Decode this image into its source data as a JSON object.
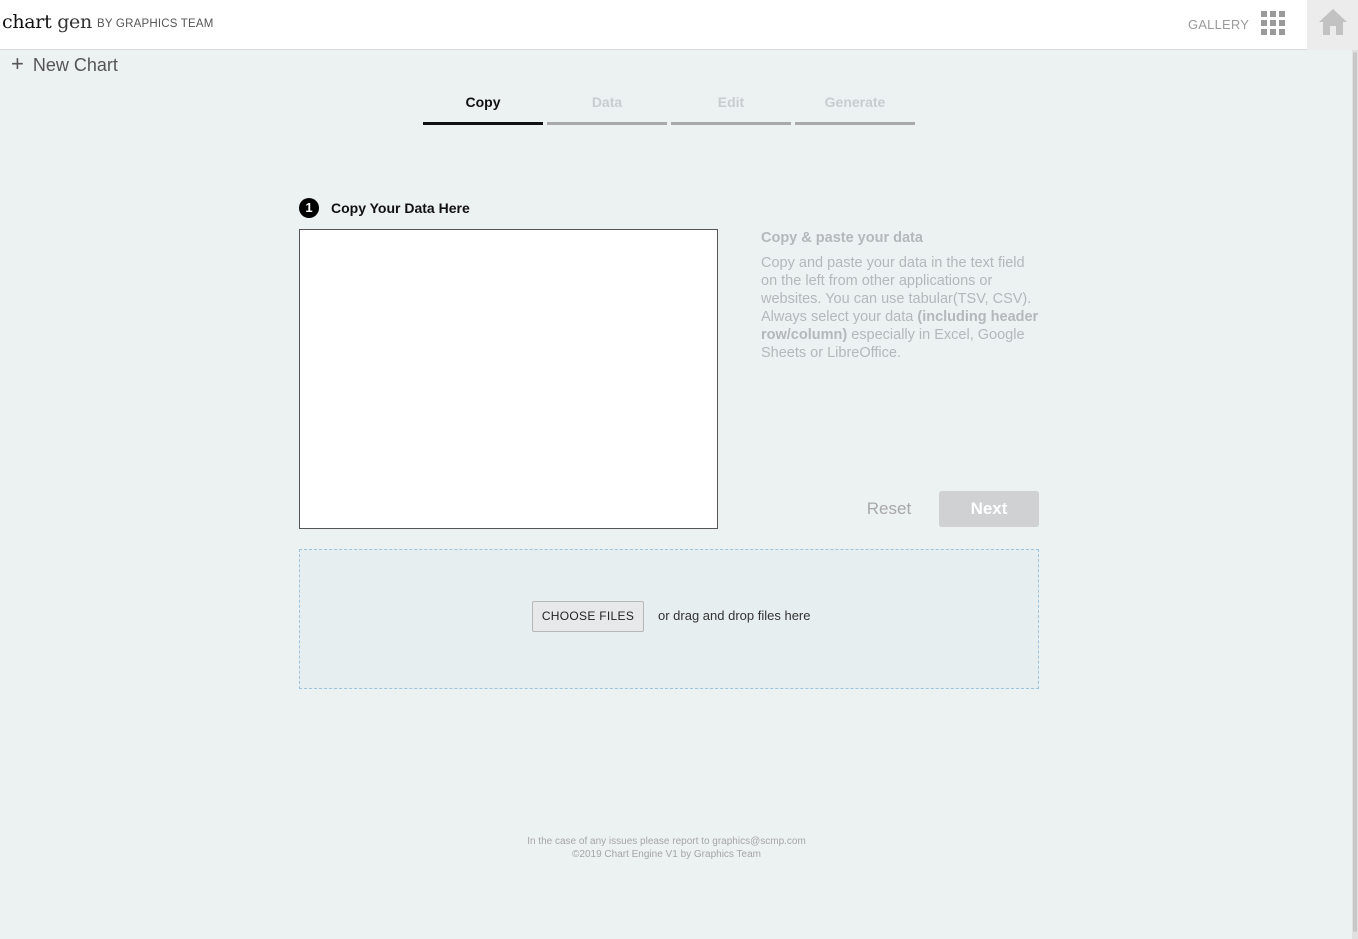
{
  "header": {
    "brand_bold": "chart",
    "brand_light": "gen",
    "byline": "BY GRAPHICS TEAM",
    "gallery_label": "GALLERY",
    "apps_icon": "grid-icon",
    "home_icon": "home-icon"
  },
  "sidebar": {
    "new_chart_label": "New Chart",
    "new_chart_icon": "+"
  },
  "steps": [
    {
      "label": "Copy",
      "active": true
    },
    {
      "label": "Data",
      "active": false
    },
    {
      "label": "Edit",
      "active": false
    },
    {
      "label": "Generate",
      "active": false
    }
  ],
  "copy_section": {
    "step_number": "1",
    "title": "Copy Your Data Here",
    "textarea_value": "",
    "help_title": "Copy & paste your data",
    "help_text_1": "Copy and paste your data in the text field on the left from other applications or websites. You can use tabular(TSV, CSV). Always select your data ",
    "help_text_bold": "(including header row/column)",
    "help_text_2": " especially in Excel, Google Sheets or LibreOffice.",
    "reset_label": "Reset",
    "next_label": "Next"
  },
  "upload": {
    "choose_label": "CHOOSE FILES",
    "drop_text": "or drag and drop files here"
  },
  "footer": {
    "line1": "In the case of any issues please report to graphics@scmp.com",
    "line2": "©2019 Chart Engine V1 by Graphics Team"
  },
  "colors": {
    "background": "#ecf1f2",
    "active_step": "#111111",
    "inactive_step": "#a9a9a9",
    "dropzone_border": "#9ec3dc"
  }
}
